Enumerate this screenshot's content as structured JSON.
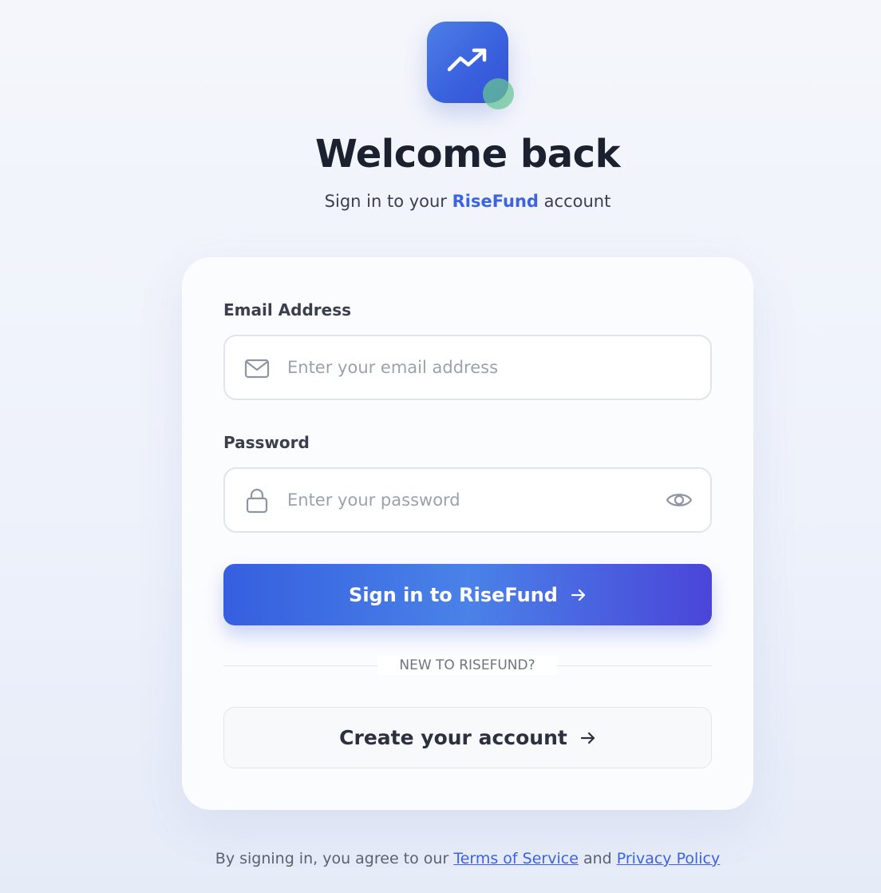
{
  "header": {
    "title": "Welcome back",
    "subtitle_prefix": "Sign in to your",
    "brand": "RiseFund",
    "subtitle_suffix": "account"
  },
  "form": {
    "email": {
      "label": "Email Address",
      "placeholder": "Enter your email address",
      "value": ""
    },
    "password": {
      "label": "Password",
      "placeholder": "Enter your password",
      "value": ""
    },
    "signin_button": "Sign in to RiseFund",
    "divider_text": "NEW TO RISEFUND?",
    "create_button": "Create your account"
  },
  "footer": {
    "prefix": "By signing in, you agree to our",
    "terms": "Terms of Service",
    "and": "and",
    "privacy": "Privacy Policy"
  },
  "icons": {
    "logo": "trending-up-icon",
    "email": "mail-icon",
    "password": "lock-icon",
    "reveal": "eye-icon",
    "arrow": "arrow-right-icon"
  },
  "colors": {
    "brand": "#3b63e3",
    "accent_green": "#68c694",
    "button_gradient_start": "#355fdf",
    "button_gradient_end": "#4a45d8"
  }
}
